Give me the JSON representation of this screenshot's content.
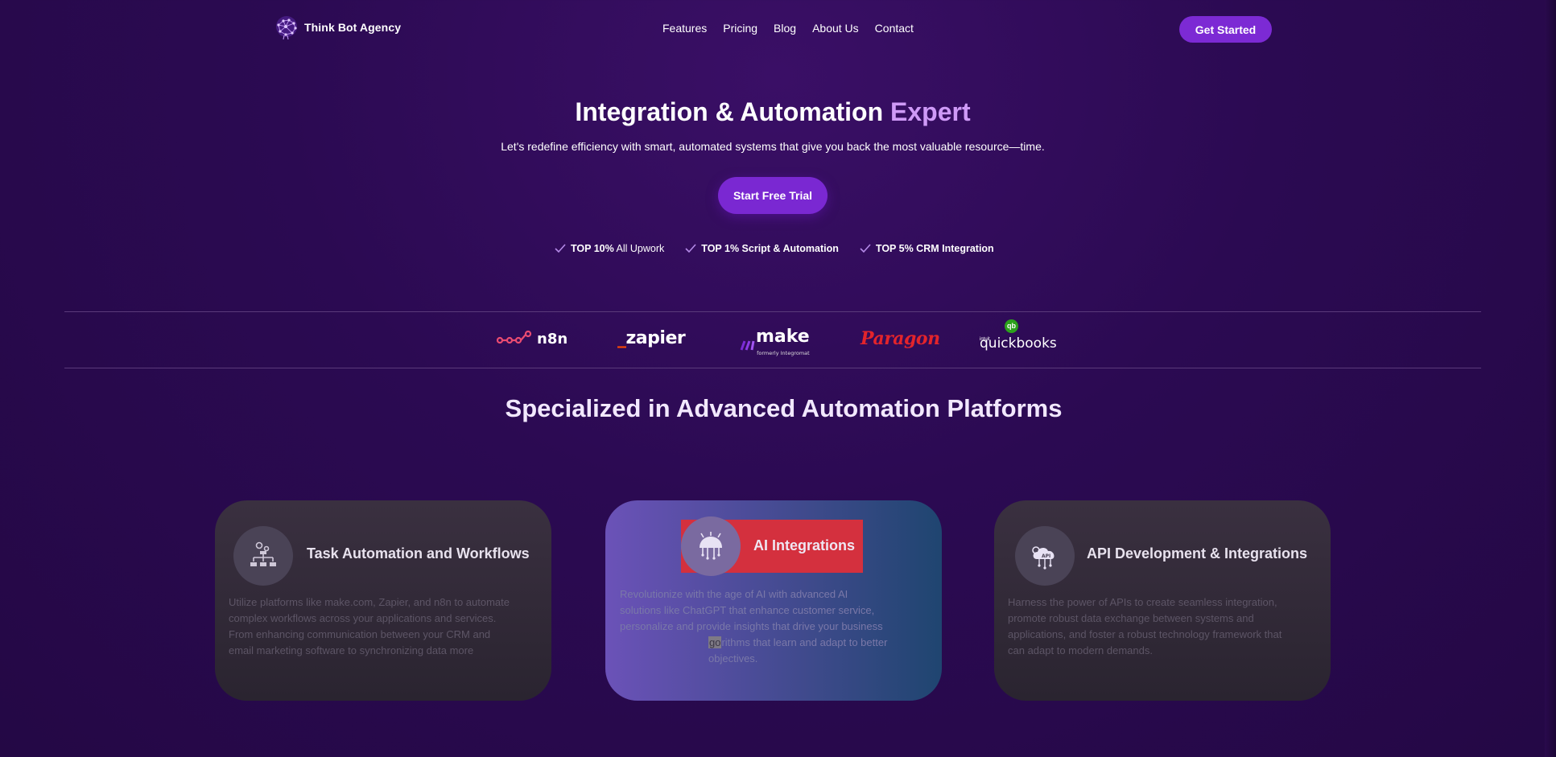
{
  "header": {
    "brand": "Think Bot Agency",
    "nav": [
      "Features",
      "Pricing",
      "Blog",
      "About Us",
      "Contact"
    ],
    "cta": "Get Started"
  },
  "hero": {
    "title_main": "Integration & Automation",
    "title_accent": "Expert",
    "subtitle": "Let's redefine efficiency with smart, automated systems that give you back the most valuable resource—time.",
    "cta": "Start Free Trial",
    "badges": [
      {
        "strong": "TOP 10%",
        "rest": " All Upwork"
      },
      {
        "strong": "TOP 1% Script & Automation",
        "rest": ""
      },
      {
        "strong": "TOP 5% CRM Integration",
        "rest": ""
      }
    ]
  },
  "logos": {
    "n8n": "n8n",
    "zapier": "zapier",
    "make": "make",
    "make_sub": "formerly Integromat",
    "paragon": "Paragon",
    "quickbooks": "quickbooks",
    "quickbooks_intuit": "intuit",
    "quickbooks_badge": "qb"
  },
  "section": {
    "title": "Specialized in Advanced Automation Platforms",
    "cards": [
      {
        "title": "Task Automation and Workflows",
        "lines": [
          "Utilize platforms like make.com, Zapier, and n8n to automate",
          "complex workflows across your applications and services.",
          "From enhancing communication between your CRM and",
          "email marketing software to synchronizing data more"
        ]
      },
      {
        "title": "AI Integrations",
        "lines": [
          "Revolutionize with the age of AI with advanced AI",
          "solutions like ChatGPT that enhance customer service,",
          "personalize and provide insights that drive your business",
          "go",
          "rithms that learn and adapt to better",
          "objectives."
        ]
      },
      {
        "title": "API Development & Integrations",
        "lines": [
          "Harness the power of APIs to create seamless integration,",
          "promote robust data exchange between systems and",
          "applications, and foster a robust technology framework that",
          "can adapt to modern demands."
        ]
      }
    ]
  },
  "icons": {
    "brand": "brain-network-icon",
    "check": "check-icon",
    "card1": "workflow-gears-icon",
    "card2": "ai-brain-icon",
    "card3": "api-cloud-icon"
  },
  "colors": {
    "accent": "#7c2ad4",
    "title_accent": "#cf9af7",
    "highlight": "#d4303e"
  }
}
